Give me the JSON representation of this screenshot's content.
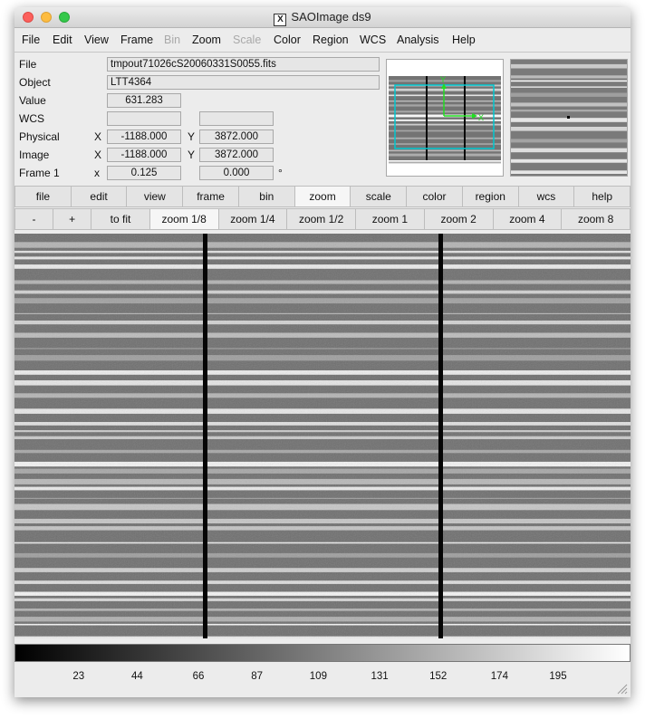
{
  "window": {
    "title": "SAOImage ds9"
  },
  "menu": {
    "items": [
      {
        "label": "File",
        "enabled": true
      },
      {
        "label": "Edit",
        "enabled": true
      },
      {
        "label": "View",
        "enabled": true
      },
      {
        "label": "Frame",
        "enabled": true
      },
      {
        "label": "Bin",
        "enabled": false
      },
      {
        "label": "Zoom",
        "enabled": true
      },
      {
        "label": "Scale",
        "enabled": false
      },
      {
        "label": "Color",
        "enabled": true
      },
      {
        "label": "Region",
        "enabled": true
      },
      {
        "label": "WCS",
        "enabled": true
      },
      {
        "label": "Analysis",
        "enabled": true
      },
      {
        "label": "Help",
        "enabled": true
      }
    ]
  },
  "info": {
    "file_label": "File",
    "file_value": "tmpout71026cS20060331S0055.fits",
    "object_label": "Object",
    "object_value": "LTT4364",
    "value_label": "Value",
    "value_value": "631.283",
    "wcs_label": "WCS",
    "wcs_value_1": "",
    "wcs_value_2": "",
    "physical_label": "Physical",
    "physical_x_label": "X",
    "physical_x": "-1188.000",
    "physical_y_label": "Y",
    "physical_y": "3872.000",
    "image_label": "Image",
    "image_x_label": "X",
    "image_x": "-1188.000",
    "image_y_label": "Y",
    "image_y": "3872.000",
    "frame_label": "Frame 1",
    "frame_x_label": "x",
    "zoom_value": "0.125",
    "angle_value": "0.000",
    "degree_symbol": "°"
  },
  "panner": {
    "x_axis_label": "X",
    "y_axis_label": "Y"
  },
  "buttonbar": [
    "file",
    "edit",
    "view",
    "frame",
    "bin",
    "zoom",
    "scale",
    "color",
    "region",
    "wcs",
    "help"
  ],
  "buttonbar_selected": "zoom",
  "zoombar": [
    "-",
    "+",
    "to fit",
    "zoom 1/8",
    "zoom 1/4",
    "zoom 1/2",
    "zoom 1",
    "zoom 2",
    "zoom 4",
    "zoom 8"
  ],
  "zoombar_selected": "zoom 1/8",
  "colorbar": {
    "ticks": [
      23,
      44,
      66,
      87,
      109,
      131,
      152,
      174,
      195
    ],
    "min": 0,
    "max": 221
  },
  "colors": {
    "accent_cyan": "#00c8d0",
    "axis_green": "#22dd22"
  },
  "icons": {
    "app": "x11-icon",
    "resize": "resize-grip-icon"
  }
}
